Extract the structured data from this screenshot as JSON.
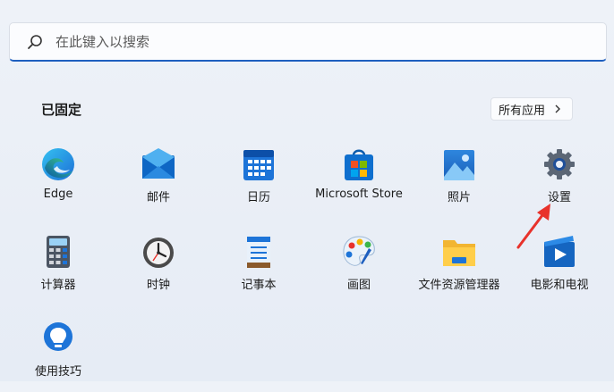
{
  "search": {
    "placeholder": "在此键入以搜索",
    "icon": "search-icon"
  },
  "pinned": {
    "title": "已固定",
    "all_apps_label": "所有应用",
    "apps": [
      {
        "label": "Edge",
        "icon": "edge-icon"
      },
      {
        "label": "邮件",
        "icon": "mail-icon"
      },
      {
        "label": "日历",
        "icon": "calendar-icon"
      },
      {
        "label": "Microsoft Store",
        "icon": "store-icon"
      },
      {
        "label": "照片",
        "icon": "photos-icon"
      },
      {
        "label": "设置",
        "icon": "gear-icon"
      },
      {
        "label": "计算器",
        "icon": "calculator-icon"
      },
      {
        "label": "时钟",
        "icon": "clock-icon"
      },
      {
        "label": "记事本",
        "icon": "notepad-icon"
      },
      {
        "label": "画图",
        "icon": "paint-icon"
      },
      {
        "label": "文件资源管理器",
        "icon": "folder-icon"
      },
      {
        "label": "电影和电视",
        "icon": "movies-icon"
      },
      {
        "label": "使用技巧",
        "icon": "tips-icon"
      }
    ]
  },
  "colors": {
    "accent": "#1e5fbf",
    "arrow": "#e8322b"
  }
}
